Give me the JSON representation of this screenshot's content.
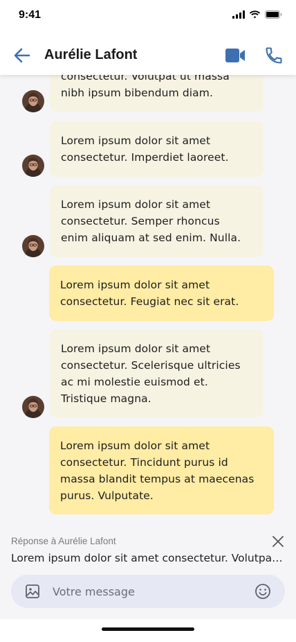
{
  "status_bar": {
    "time": "9:41"
  },
  "header": {
    "contact_name": "Aurélie Lafont",
    "accent": "#3e6fb0"
  },
  "messages": [
    {
      "direction": "incoming",
      "text": "consectetur. Volutpat ut massa\nnibh ipsum bibendum diam.",
      "avatar": true
    },
    {
      "direction": "incoming",
      "text": "Lorem ipsum dolor sit amet\nconsectetur. Imperdiet laoreet.",
      "avatar": true
    },
    {
      "direction": "incoming",
      "text": "Lorem ipsum dolor sit amet\nconsectetur. Semper rhoncus\nenim aliquam at sed enim. Nulla.",
      "avatar": true
    },
    {
      "direction": "outgoing",
      "text": "Lorem ipsum dolor sit amet\nconsectetur. Feugiat nec sit erat.",
      "avatar": false
    },
    {
      "direction": "incoming",
      "text": "Lorem ipsum dolor sit amet\nconsectetur. Scelerisque ultricies\nac mi molestie euismod et.\nTristique magna.",
      "avatar": true
    },
    {
      "direction": "outgoing",
      "text": "Lorem ipsum dolor sit amet\nconsectetur. Tincidunt purus id\nmassa blandit tempus at maecenas\npurus. Vulputate.",
      "avatar": false
    }
  ],
  "reply": {
    "label": "Réponse à Aurélie Lafont",
    "preview": "Lorem ipsum dolor sit amet consectetur. Volutpat ut massa nibh ipsum bibendum diam."
  },
  "composer": {
    "placeholder": "Votre message",
    "value": ""
  },
  "colors": {
    "incoming_bubble": "#f7f3e3",
    "outgoing_bubble": "#ffeca5",
    "composer_bg": "#e6e8f4",
    "icon_blue": "#3e6fb0"
  },
  "icons": {
    "back": "arrow-left-icon",
    "video": "video-camera-icon",
    "phone": "phone-icon",
    "close": "close-icon",
    "image": "image-icon",
    "emoji": "emoji-icon"
  }
}
